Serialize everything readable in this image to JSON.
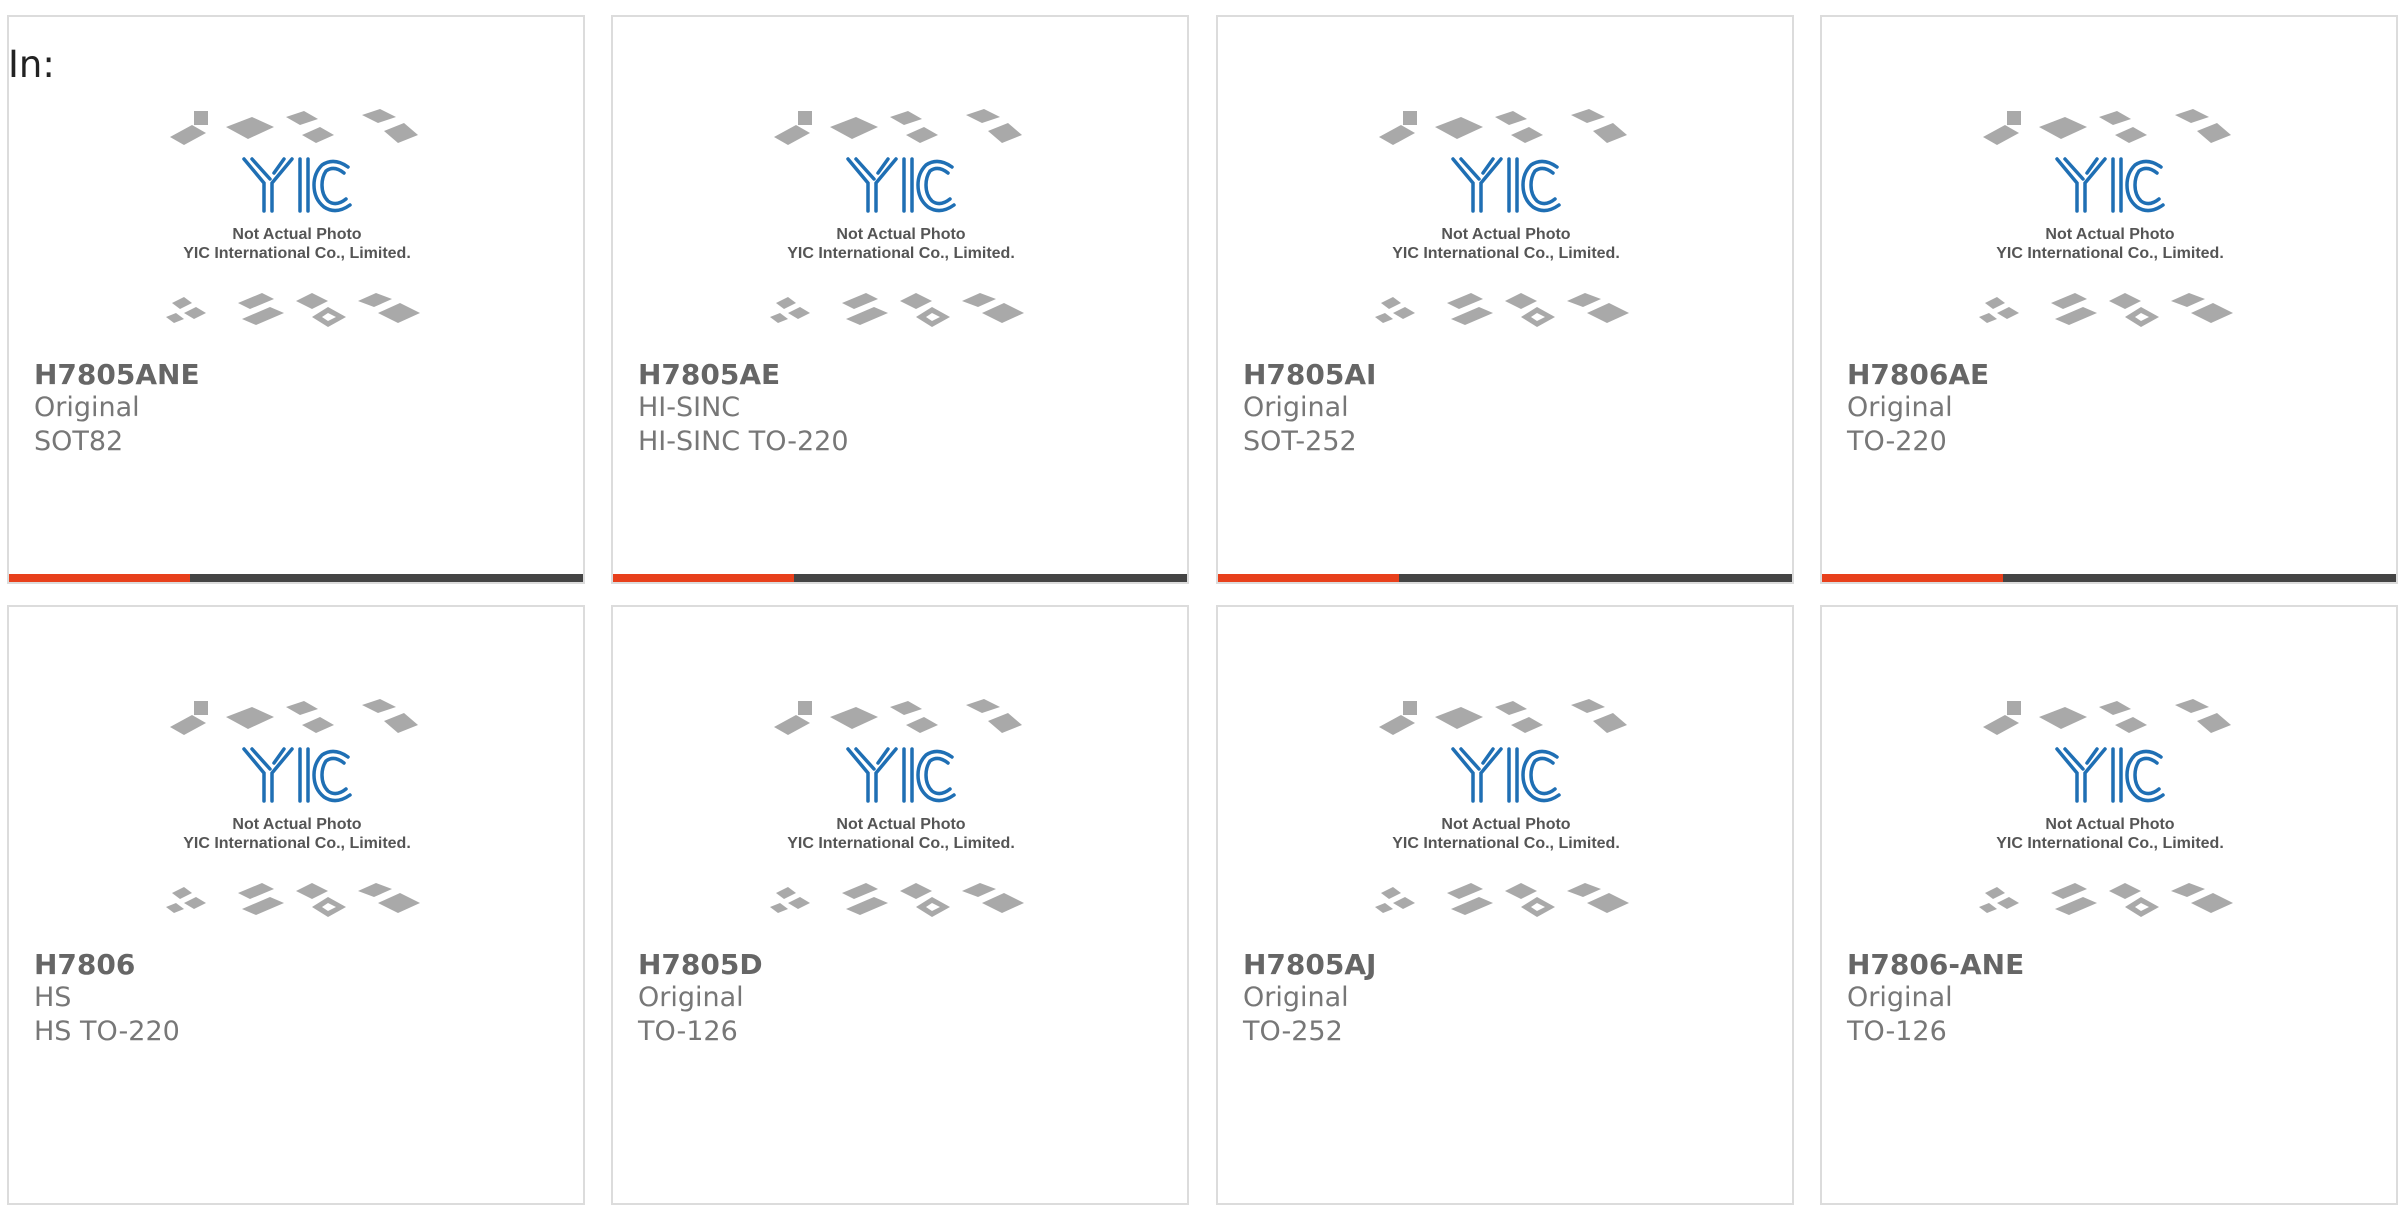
{
  "header": {
    "in_label": "In:"
  },
  "placeholder_image": {
    "line1": "Not Actual Photo",
    "line2": "YIC International Co., Limited.",
    "logo_text": "YIC",
    "logo_color": "#1f6fb4",
    "chip_color": "#a9a9a9"
  },
  "colors": {
    "accent": "#e8401c",
    "bar_track": "#444444",
    "card_border": "#dcdcdc"
  },
  "progress_fraction": 0.315,
  "products": [
    {
      "part": "H7805ANE",
      "brand": "Original",
      "package": "SOT82"
    },
    {
      "part": "H7805AE",
      "brand": "HI-SINC",
      "package": "HI-SINC TO-220"
    },
    {
      "part": "H7805AI",
      "brand": "Original",
      "package": "SOT-252"
    },
    {
      "part": "H7806AE",
      "brand": "Original",
      "package": "TO-220"
    },
    {
      "part": "H7806",
      "brand": "HS",
      "package": "HS TO-220"
    },
    {
      "part": "H7805D",
      "brand": "Original",
      "package": "TO-126"
    },
    {
      "part": "H7805AJ",
      "brand": "Original",
      "package": "TO-252"
    },
    {
      "part": "H7806-ANE",
      "brand": "Original",
      "package": "TO-126"
    }
  ]
}
